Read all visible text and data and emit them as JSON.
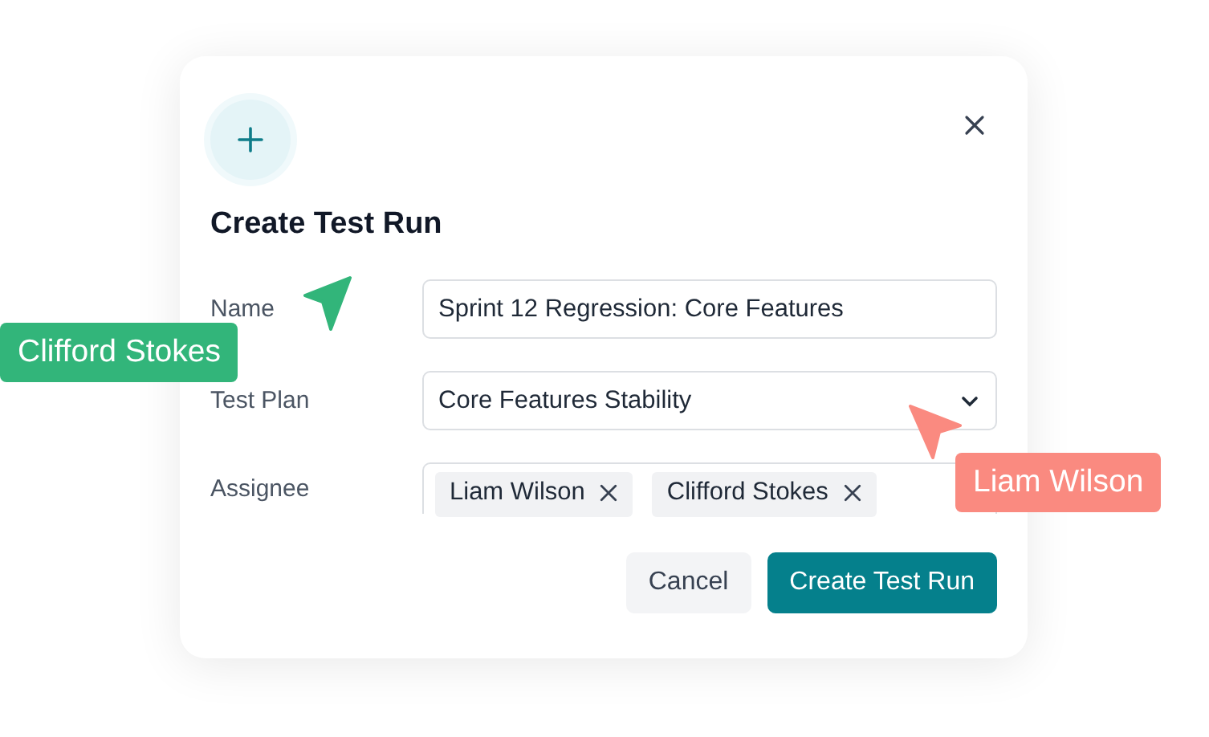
{
  "dialog": {
    "title": "Create Test Run",
    "fields": [
      {
        "label": "Name",
        "kind": "text",
        "value": "Sprint 12 Regression: Core Features"
      },
      {
        "label": "Test Plan",
        "kind": "select",
        "value": "Core Features Stability"
      },
      {
        "label": "Assignee",
        "kind": "tags",
        "tags": [
          "Liam Wilson",
          "Clifford Stokes"
        ]
      }
    ],
    "buttons": [
      {
        "label": "Cancel",
        "kind": "secondary"
      },
      {
        "label": "Create Test Run",
        "kind": "primary"
      }
    ]
  },
  "cursors": [
    {
      "name": "Clifford Stokes",
      "color": "#32b57a"
    },
    {
      "name": "Liam Wilson",
      "color": "#fa8a80"
    }
  ]
}
